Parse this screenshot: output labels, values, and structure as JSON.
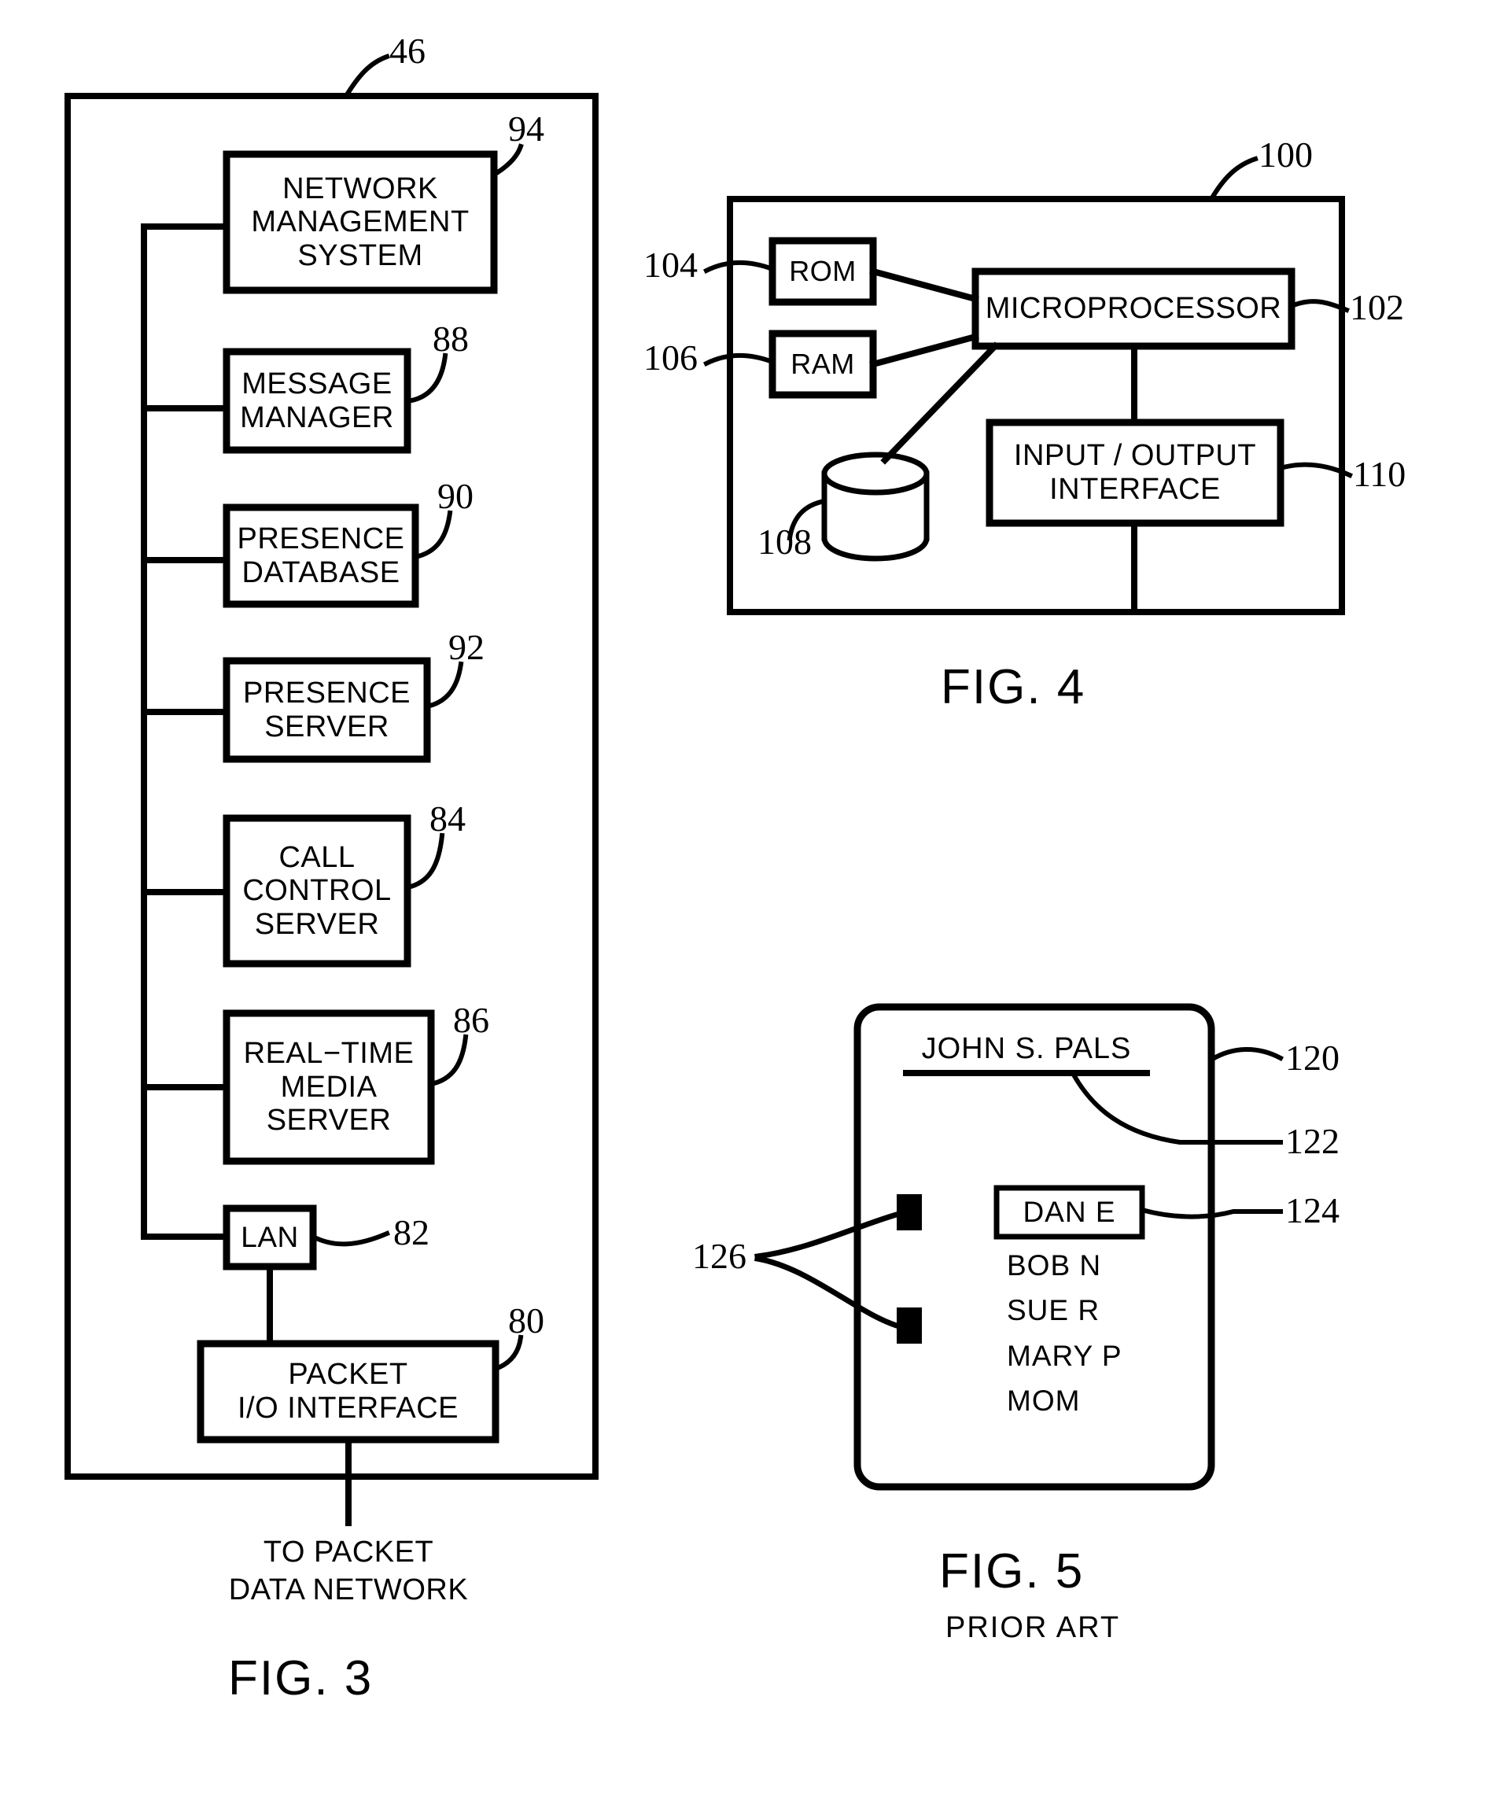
{
  "figures": {
    "fig3": {
      "caption": "FIG. 3",
      "outer_ref": "46",
      "note_line1": "TO  PACKET",
      "note_line2": "DATA  NETWORK",
      "blocks": [
        {
          "label": "NETWORK\nMANAGEMENT\nSYSTEM",
          "lines": [
            "NETWORK",
            "MANAGEMENT",
            "SYSTEM"
          ],
          "ref": "94"
        },
        {
          "label": "MESSAGE\nMANAGER",
          "lines": [
            "MESSAGE",
            "MANAGER"
          ],
          "ref": "88"
        },
        {
          "label": "PRESENCE\nDATABASE",
          "lines": [
            "PRESENCE",
            "DATABASE"
          ],
          "ref": "90"
        },
        {
          "label": "PRESENCE\nSERVER",
          "lines": [
            "PRESENCE",
            "SERVER"
          ],
          "ref": "92"
        },
        {
          "label": "CALL\nCONTROL\nSERVER",
          "lines": [
            "CALL",
            "CONTROL",
            "SERVER"
          ],
          "ref": "84"
        },
        {
          "label": "REAL-TIME\nMEDIA\nSERVER",
          "lines": [
            "REAL−TIME",
            "MEDIA",
            "SERVER"
          ],
          "ref": "86"
        },
        {
          "label": "LAN",
          "lines": [
            "LAN"
          ],
          "ref": "82"
        },
        {
          "label": "PACKET\nI/O INTERFACE",
          "lines": [
            "PACKET",
            "I/O  INTERFACE"
          ],
          "ref": "80"
        }
      ]
    },
    "fig4": {
      "caption": "FIG. 4",
      "outer_ref": "100",
      "blocks": [
        {
          "label": "ROM",
          "ref": "104"
        },
        {
          "label": "RAM",
          "ref": "106"
        },
        {
          "label": "MICROPROCESSOR",
          "ref": "102"
        },
        {
          "label": "INPUT / OUTPUT\nINTERFACE",
          "lines": [
            "INPUT / OUTPUT",
            "INTERFACE"
          ],
          "ref": "110"
        },
        {
          "label": "disk-storage",
          "ref": "108"
        }
      ]
    },
    "fig5": {
      "caption": "FIG. 5",
      "subcaption": "PRIOR ART",
      "outer_ref": "120",
      "title": "JOHN  S. PALS",
      "title_ref": "122",
      "selected_entry": "DAN  E",
      "selected_ref": "124",
      "indicator_ref": "126",
      "entries": [
        "DAN  E",
        "BOB  N",
        "SUE  R",
        "MARY  P",
        "MOM"
      ],
      "list_after_selected": [
        "BOB  N",
        "SUE  R",
        "MARY  P",
        "MOM"
      ]
    }
  },
  "colors": {
    "ink": "#000000",
    "paper": "#ffffff"
  }
}
